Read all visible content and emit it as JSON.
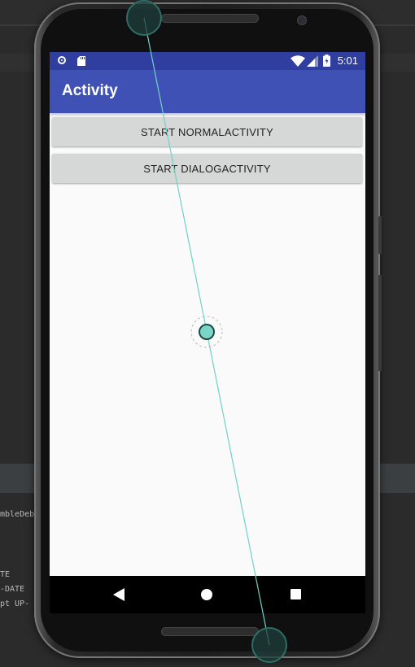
{
  "status_bar": {
    "time": "5:01",
    "icons": [
      "notification-circle-icon",
      "sd-card-icon",
      "wifi-icon",
      "cell-signal-icon",
      "battery-charging-icon"
    ]
  },
  "app_bar": {
    "title": "Activity"
  },
  "buttons": {
    "start_normal": "START NORMALACTIVITY",
    "start_dialog": "START DIALOGACTIVITY"
  },
  "nav_bar": {
    "icons": [
      "back-icon",
      "home-icon",
      "recents-icon"
    ]
  },
  "background_console": {
    "lines": [
      "mbleDeb",
      "",
      "",
      "",
      "TE",
      "-DATE",
      "pt UP-"
    ]
  },
  "colors": {
    "status_bar": "#303f9f",
    "app_bar": "#3f51b5",
    "button": "#d6d7d7",
    "screen_background": "#fafafa",
    "touch_indicator": "#7ad6c8"
  }
}
